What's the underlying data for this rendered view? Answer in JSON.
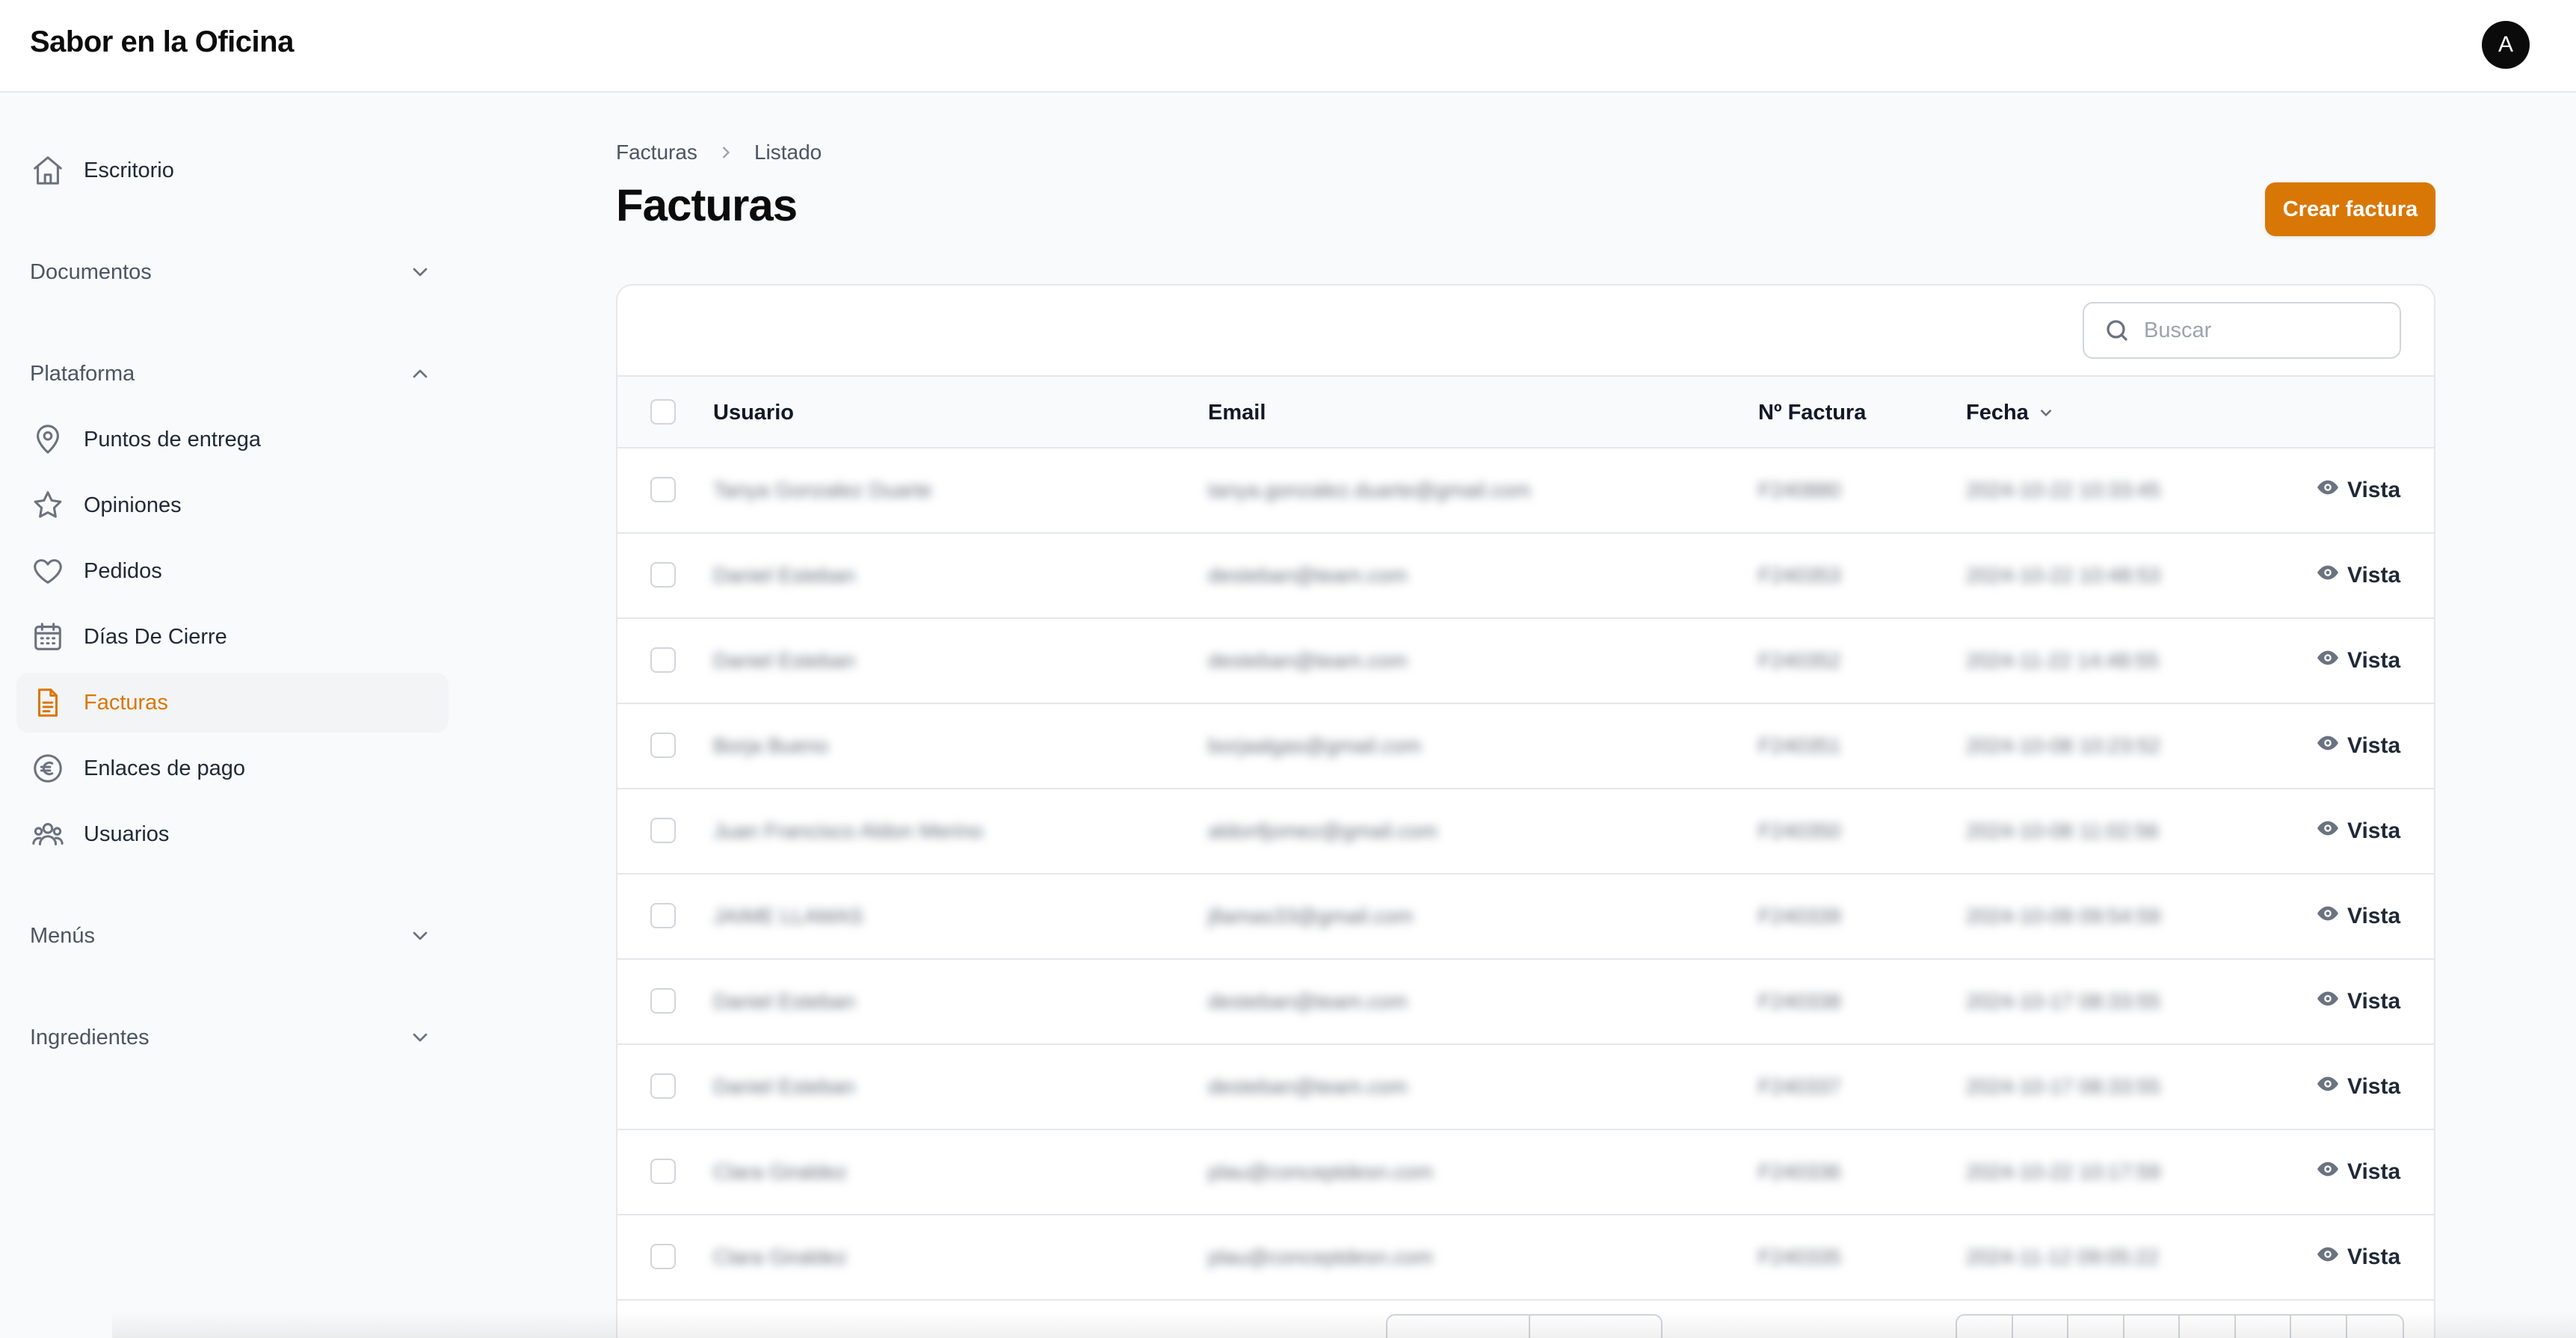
{
  "app": {
    "title": "Sabor en la Oficina",
    "avatar_initial": "A"
  },
  "sidebar": {
    "dashboard": {
      "label": "Escritorio",
      "icon": "home-icon"
    },
    "groups": {
      "documentos": {
        "label": "Documentos",
        "expanded": false
      },
      "plataforma": {
        "label": "Plataforma",
        "expanded": true
      },
      "menus": {
        "label": "Menús",
        "expanded": false
      },
      "ingredientes": {
        "label": "Ingredientes",
        "expanded": false
      }
    },
    "plataforma_items": [
      {
        "label": "Puntos de entrega",
        "icon": "map-pin-icon"
      },
      {
        "label": "Opiniones",
        "icon": "star-icon"
      },
      {
        "label": "Pedidos",
        "icon": "heart-icon"
      },
      {
        "label": "Días De Cierre",
        "icon": "calendar-icon"
      },
      {
        "label": "Facturas",
        "icon": "document-icon",
        "active": true
      },
      {
        "label": "Enlaces de pago",
        "icon": "euro-icon"
      },
      {
        "label": "Usuarios",
        "icon": "users-icon"
      }
    ]
  },
  "breadcrumb": {
    "root": "Facturas",
    "current": "Listado"
  },
  "page": {
    "title": "Facturas",
    "create_button": "Crear factura"
  },
  "search": {
    "placeholder": "Buscar",
    "value": ""
  },
  "table": {
    "columns": {
      "usuario": "Usuario",
      "email": "Email",
      "numero": "Nº Factura",
      "fecha": "Fecha"
    },
    "sort": {
      "column": "Fecha",
      "direction": "desc"
    },
    "row_action": "Vista",
    "rows": [
      {
        "usuario": "Tanya Gonzalez Duarte",
        "email": "tanya.gonzalez.duarte@gmail.com",
        "numero": "F240880",
        "fecha": "2024-10-22 10:33:45"
      },
      {
        "usuario": "Daniel Esteban",
        "email": "desteban@team.com",
        "numero": "F240353",
        "fecha": "2024-10-22 10:48:53"
      },
      {
        "usuario": "Daniel Esteban",
        "email": "desteban@team.com",
        "numero": "F240352",
        "fecha": "2024-11-22 14:48:55"
      },
      {
        "usuario": "Borja Bueno",
        "email": "borjaalgas@gmail.com",
        "numero": "F240351",
        "fecha": "2024-10-08 10:23:52"
      },
      {
        "usuario": "Juan Francisco Aldon Merino",
        "email": "aldonfjomez@gmail.com",
        "numero": "F240350",
        "fecha": "2024-10-08 11:02:56"
      },
      {
        "usuario": "JAIME LLAMAS",
        "email": "jllamas33@gmail.com",
        "numero": "F240339",
        "fecha": "2024-10-09 09:54:59"
      },
      {
        "usuario": "Daniel Esteban",
        "email": "desteban@team.com",
        "numero": "F240338",
        "fecha": "2024-10-17 08:33:55"
      },
      {
        "usuario": "Daniel Esteban",
        "email": "desteban@team.com",
        "numero": "F240337",
        "fecha": "2024-10-17 08:33:55"
      },
      {
        "usuario": "Clara Giraldez",
        "email": "plau@conceptdesn.com",
        "numero": "F240336",
        "fecha": "2024-10-22 10:17:59"
      },
      {
        "usuario": "Clara Giraldez",
        "email": "plau@conceptdesn.com",
        "numero": "F240335",
        "fecha": "2024-11-12 09:05:22"
      }
    ]
  },
  "colors": {
    "accent": "#d97706",
    "text": "#111827",
    "muted": "#6b7280",
    "border": "#e5e7eb"
  }
}
